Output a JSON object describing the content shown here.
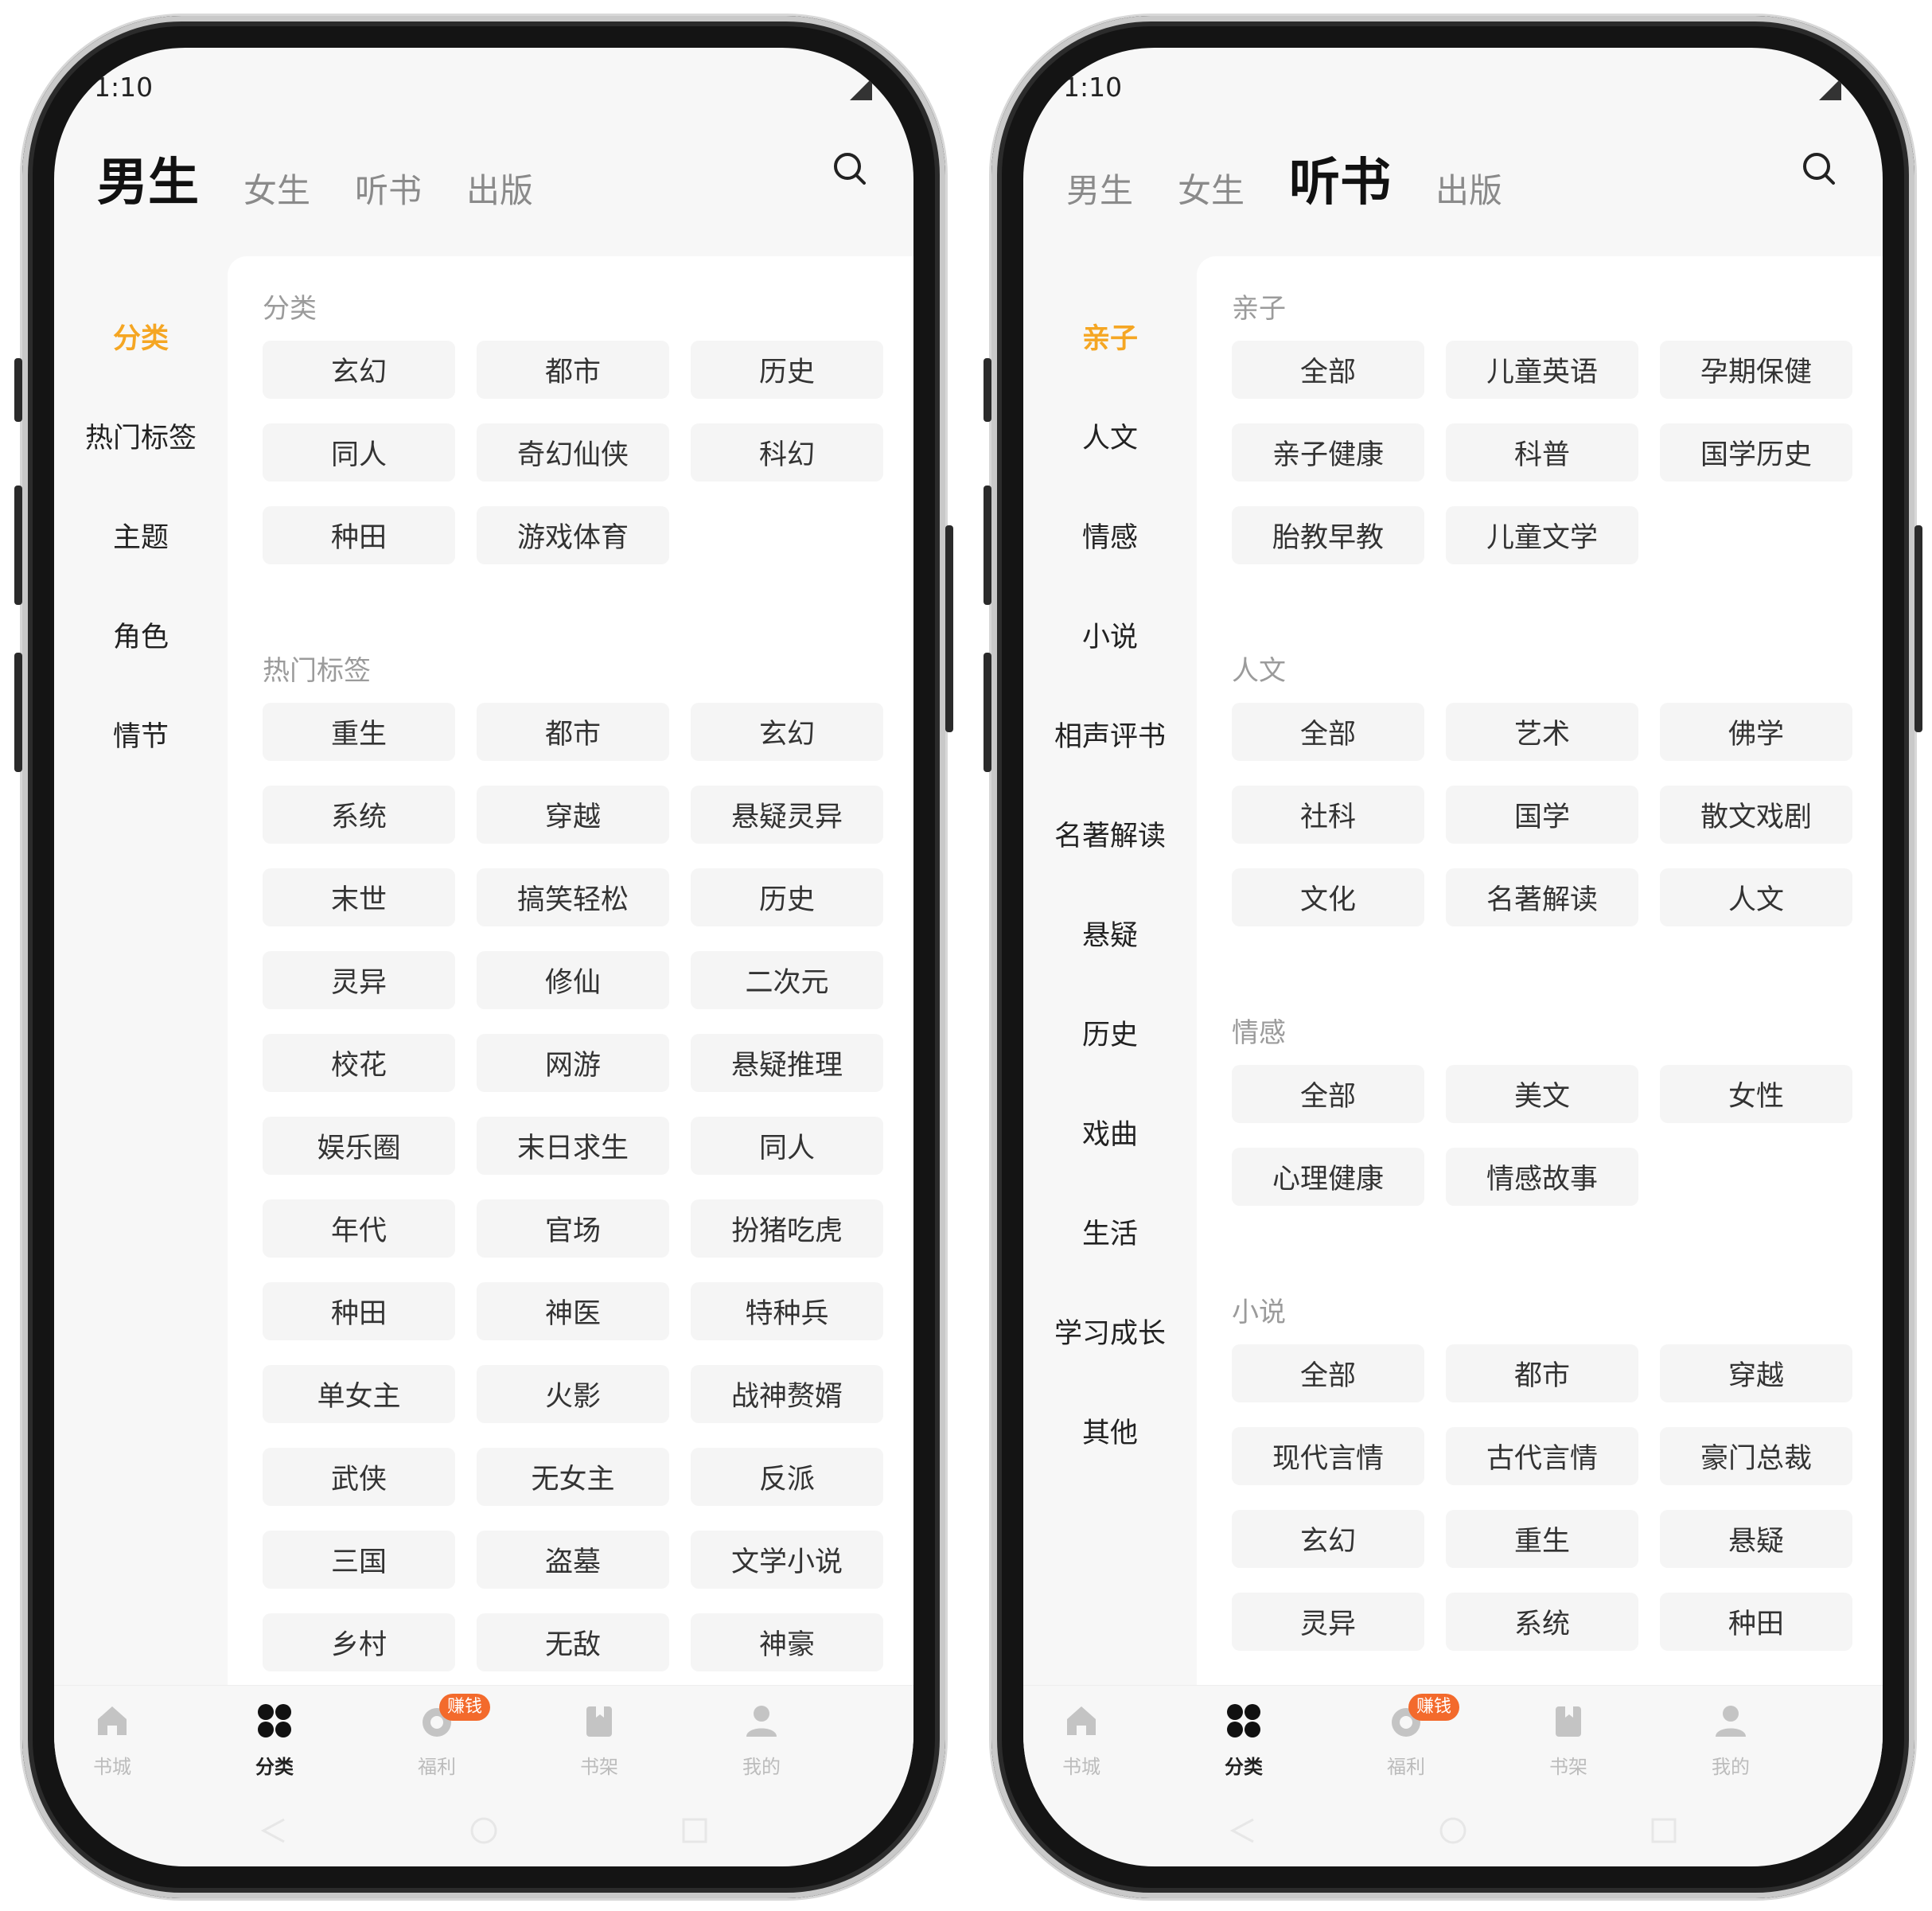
{
  "status_time": "1:10",
  "top_tabs": [
    "男生",
    "女生",
    "听书",
    "出版"
  ],
  "bottom_nav": [
    {
      "label": "书城",
      "icon": "home-icon"
    },
    {
      "label": "分类",
      "icon": "category-grid-icon"
    },
    {
      "label": "福利",
      "icon": "coin-icon",
      "badge": "赚钱"
    },
    {
      "label": "书架",
      "icon": "bookshelf-icon"
    },
    {
      "label": "我的",
      "icon": "user-icon"
    }
  ],
  "colors": {
    "accent": "#f5a623",
    "badge": "#f36a2c"
  },
  "screens": [
    {
      "active_tab": 0,
      "active_bottom": 1,
      "side_nav": [
        "分类",
        "热门标签",
        "主题",
        "角色",
        "情节"
      ],
      "sections": [
        {
          "title": "分类",
          "items": [
            "玄幻",
            "都市",
            "历史",
            "同人",
            "奇幻仙侠",
            "科幻",
            "种田",
            "游戏体育"
          ]
        },
        {
          "title": "热门标签",
          "items": [
            "重生",
            "都市",
            "玄幻",
            "系统",
            "穿越",
            "悬疑灵异",
            "末世",
            "搞笑轻松",
            "历史",
            "灵异",
            "修仙",
            "二次元",
            "校花",
            "网游",
            "悬疑推理",
            "娱乐圈",
            "末日求生",
            "同人",
            "年代",
            "官场",
            "扮猪吃虎",
            "种田",
            "神医",
            "特种兵",
            "单女主",
            "火影",
            "战神赘婿",
            "武侠",
            "无女主",
            "反派",
            "三国",
            "盗墓",
            "文学小说",
            "乡村",
            "无敌",
            "神豪"
          ]
        }
      ]
    },
    {
      "active_tab": 2,
      "active_bottom": 1,
      "side_nav": [
        "亲子",
        "人文",
        "情感",
        "小说",
        "相声评书",
        "名著解读",
        "悬疑",
        "历史",
        "戏曲",
        "生活",
        "学习成长",
        "其他"
      ],
      "sections": [
        {
          "title": "亲子",
          "items": [
            "全部",
            "儿童英语",
            "孕期保健",
            "亲子健康",
            "科普",
            "国学历史",
            "胎教早教",
            "儿童文学"
          ]
        },
        {
          "title": "人文",
          "items": [
            "全部",
            "艺术",
            "佛学",
            "社科",
            "国学",
            "散文戏剧",
            "文化",
            "名著解读",
            "人文"
          ]
        },
        {
          "title": "情感",
          "items": [
            "全部",
            "美文",
            "女性",
            "心理健康",
            "情感故事"
          ]
        },
        {
          "title": "小说",
          "items": [
            "全部",
            "都市",
            "穿越",
            "现代言情",
            "古代言情",
            "豪门总裁",
            "玄幻",
            "重生",
            "悬疑",
            "灵异",
            "系统",
            "种田"
          ]
        }
      ]
    }
  ]
}
